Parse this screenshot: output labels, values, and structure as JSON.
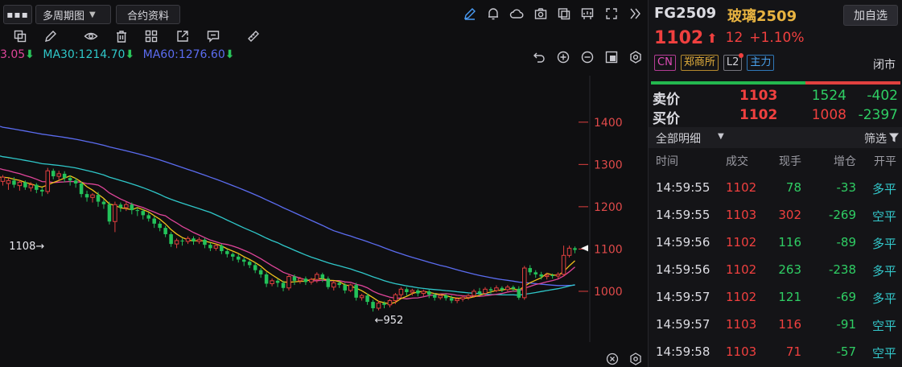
{
  "toolbar": {
    "more_label": "▪▪▪",
    "period_label": "多周期图",
    "contract_label": "合约资料"
  },
  "icons": {
    "top": [
      "pencil-icon",
      "bell-icon",
      "cloud-icon",
      "camera-icon",
      "window-icon",
      "monitor-icon",
      "fullscreen-icon",
      "collapse-icon"
    ],
    "draw": [
      "layers-icon",
      "edit-icon",
      "eye-icon",
      "trash-icon",
      "grid-icon",
      "share-icon",
      "comment-icon",
      "ruler-icon"
    ],
    "chart": [
      "undo-icon",
      "zoom-in-icon",
      "zoom-out-icon",
      "reset-icon",
      "settings-icon"
    ]
  },
  "ma_legend": {
    "ma10_text": "3.05",
    "ma30_text": "MA30:1214.70",
    "ma60_text": "MA60:1276.60",
    "arrow": "⬇"
  },
  "chart_data": {
    "type": "candlestick",
    "y_ticks": [
      1400,
      1300,
      1200,
      1100,
      1000
    ],
    "ylim": [
      880,
      1510
    ],
    "high_marker": {
      "label": "1108→",
      "value": 1108
    },
    "low_marker": {
      "label": "←952",
      "value": 952
    },
    "current_price": 1102,
    "ma_colors": {
      "ma5": "#f2c21b",
      "ma10": "#e0459a",
      "ma30": "#2fc7c9",
      "ma60": "#5b6cf0"
    },
    "candles": [
      [
        1260,
        1270,
        1250,
        1275
      ],
      [
        1255,
        1262,
        1240,
        1268
      ],
      [
        1262,
        1252,
        1245,
        1270
      ],
      [
        1250,
        1258,
        1238,
        1263
      ],
      [
        1258,
        1246,
        1240,
        1262
      ],
      [
        1245,
        1252,
        1236,
        1258
      ],
      [
        1252,
        1240,
        1232,
        1256
      ],
      [
        1240,
        1236,
        1225,
        1245
      ],
      [
        1236,
        1285,
        1230,
        1292
      ],
      [
        1285,
        1272,
        1265,
        1290
      ],
      [
        1272,
        1278,
        1262,
        1285
      ],
      [
        1278,
        1268,
        1258,
        1284
      ],
      [
        1268,
        1262,
        1250,
        1274
      ],
      [
        1262,
        1255,
        1245,
        1268
      ],
      [
        1255,
        1230,
        1222,
        1260
      ],
      [
        1230,
        1222,
        1212,
        1238
      ],
      [
        1222,
        1228,
        1210,
        1232
      ],
      [
        1228,
        1212,
        1200,
        1235
      ],
      [
        1212,
        1206,
        1195,
        1218
      ],
      [
        1206,
        1165,
        1158,
        1212
      ],
      [
        1165,
        1205,
        1140,
        1212
      ],
      [
        1205,
        1198,
        1188,
        1210
      ],
      [
        1198,
        1205,
        1190,
        1212
      ],
      [
        1205,
        1192,
        1182,
        1210
      ],
      [
        1192,
        1190,
        1178,
        1198
      ],
      [
        1190,
        1180,
        1170,
        1195
      ],
      [
        1180,
        1172,
        1165,
        1186
      ],
      [
        1172,
        1160,
        1150,
        1178
      ],
      [
        1160,
        1150,
        1142,
        1166
      ],
      [
        1150,
        1135,
        1128,
        1155
      ],
      [
        1135,
        1112,
        1105,
        1140
      ],
      [
        1112,
        1120,
        1102,
        1125
      ],
      [
        1120,
        1118,
        1108,
        1125
      ],
      [
        1118,
        1125,
        1112,
        1130
      ],
      [
        1125,
        1118,
        1110,
        1130
      ],
      [
        1118,
        1122,
        1112,
        1128
      ],
      [
        1122,
        1110,
        1102,
        1126
      ],
      [
        1110,
        1102,
        1095,
        1115
      ],
      [
        1102,
        1108,
        1096,
        1112
      ],
      [
        1108,
        1095,
        1088,
        1112
      ],
      [
        1095,
        1088,
        1080,
        1100
      ],
      [
        1088,
        1082,
        1072,
        1092
      ],
      [
        1082,
        1075,
        1068,
        1088
      ],
      [
        1075,
        1070,
        1060,
        1080
      ],
      [
        1070,
        1062,
        1055,
        1074
      ],
      [
        1062,
        1050,
        1043,
        1068
      ],
      [
        1050,
        1040,
        1032,
        1055
      ],
      [
        1040,
        1018,
        1010,
        1045
      ],
      [
        1018,
        1025,
        1012,
        1030
      ],
      [
        1025,
        1020,
        1010,
        1030
      ],
      [
        1020,
        1008,
        1000,
        1025
      ],
      [
        1008,
        1035,
        1002,
        1040
      ],
      [
        1035,
        1025,
        1015,
        1040
      ],
      [
        1025,
        1030,
        1018,
        1034
      ],
      [
        1030,
        1022,
        1015,
        1035
      ],
      [
        1022,
        1028,
        1016,
        1032
      ],
      [
        1028,
        1040,
        1020,
        1045
      ],
      [
        1040,
        1030,
        1022,
        1044
      ],
      [
        1030,
        1010,
        1005,
        1035
      ],
      [
        1010,
        1020,
        1002,
        1025
      ],
      [
        1020,
        1015,
        1008,
        1024
      ],
      [
        1015,
        1002,
        995,
        1020
      ],
      [
        1002,
        1015,
        998,
        1018
      ],
      [
        1015,
        985,
        978,
        1020
      ],
      [
        985,
        990,
        978,
        994
      ],
      [
        990,
        975,
        968,
        995
      ],
      [
        975,
        960,
        952,
        980
      ],
      [
        960,
        972,
        955,
        978
      ],
      [
        972,
        968,
        960,
        976
      ],
      [
        968,
        978,
        962,
        982
      ],
      [
        978,
        992,
        970,
        996
      ],
      [
        992,
        1005,
        985,
        1010
      ],
      [
        1005,
        998,
        990,
        1010
      ],
      [
        998,
        1002,
        990,
        1006
      ],
      [
        1002,
        995,
        988,
        1006
      ],
      [
        995,
        1000,
        988,
        1004
      ],
      [
        1000,
        992,
        984,
        1004
      ],
      [
        992,
        985,
        978,
        996
      ],
      [
        985,
        990,
        980,
        994
      ],
      [
        990,
        984,
        978,
        994
      ],
      [
        984,
        978,
        972,
        990
      ],
      [
        978,
        982,
        972,
        986
      ],
      [
        982,
        986,
        976,
        990
      ],
      [
        986,
        990,
        980,
        994
      ],
      [
        990,
        1000,
        985,
        1005
      ],
      [
        1000,
        995,
        990,
        1008
      ],
      [
        995,
        1005,
        990,
        1010
      ],
      [
        1005,
        1002,
        995,
        1010
      ],
      [
        1002,
        1008,
        998,
        1014
      ],
      [
        1008,
        1004,
        998,
        1012
      ],
      [
        1004,
        1010,
        1000,
        1015
      ],
      [
        1010,
        1006,
        1000,
        1014
      ],
      [
        1006,
        985,
        980,
        1012
      ],
      [
        985,
        1055,
        980,
        1060
      ],
      [
        1055,
        1045,
        1038,
        1062
      ],
      [
        1045,
        1040,
        1032,
        1050
      ],
      [
        1040,
        1035,
        1028,
        1046
      ],
      [
        1035,
        1038,
        1028,
        1044
      ],
      [
        1038,
        1036,
        1030,
        1042
      ],
      [
        1036,
        1040,
        1030,
        1045
      ],
      [
        1040,
        1085,
        1035,
        1108
      ],
      [
        1085,
        1102,
        1080,
        1108
      ],
      [
        1102,
        1098,
        1090,
        1106
      ]
    ]
  },
  "quote": {
    "code": "FG2509",
    "name": "玻璃2509",
    "watch_label": "加自选",
    "last_price": "1102",
    "up_arrow": "⬆",
    "change": "12",
    "pct": "+1.10%",
    "tags": {
      "cn": "CN",
      "exchange": "郑商所",
      "l2": "L2",
      "main": "主力"
    },
    "status": "闭市",
    "buy_ratio": 0.62,
    "ask": {
      "label": "卖价",
      "price": "1103",
      "vol": "1524",
      "chg": "-402"
    },
    "bid": {
      "label": "买价",
      "price": "1102",
      "vol": "1008",
      "chg": "-2397"
    }
  },
  "detail": {
    "title": "全部明细",
    "filter_label": "筛选",
    "columns": {
      "time": "时间",
      "price": "成交",
      "vol": "现手",
      "oi": "增仓",
      "type": "开平"
    },
    "rows": [
      {
        "time": "14:59:55",
        "price": "1102",
        "vol": "78",
        "oi": "-33",
        "type": "多平",
        "vol_color": "#2fce64"
      },
      {
        "time": "14:59:55",
        "price": "1103",
        "vol": "302",
        "oi": "-269",
        "type": "空平",
        "vol_color": "#f0403f"
      },
      {
        "time": "14:59:56",
        "price": "1102",
        "vol": "116",
        "oi": "-89",
        "type": "多平",
        "vol_color": "#2fce64"
      },
      {
        "time": "14:59:56",
        "price": "1102",
        "vol": "263",
        "oi": "-238",
        "type": "多平",
        "vol_color": "#2fce64"
      },
      {
        "time": "14:59:57",
        "price": "1102",
        "vol": "121",
        "oi": "-69",
        "type": "多平",
        "vol_color": "#2fce64"
      },
      {
        "time": "14:59:57",
        "price": "1103",
        "vol": "116",
        "oi": "-91",
        "type": "空平",
        "vol_color": "#f0403f"
      },
      {
        "time": "14:59:58",
        "price": "1103",
        "vol": "71",
        "oi": "-57",
        "type": "空平",
        "vol_color": "#f0403f"
      }
    ]
  }
}
